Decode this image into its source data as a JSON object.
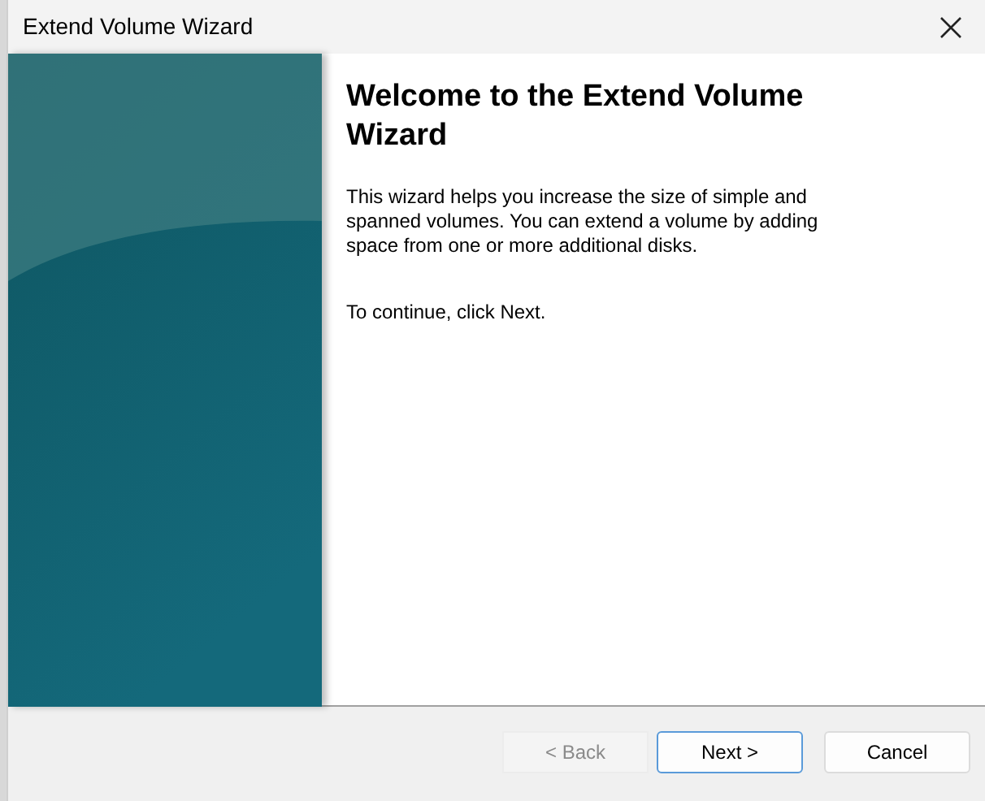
{
  "window": {
    "title": "Extend Volume Wizard"
  },
  "heading": "Welcome to the Extend Volume Wizard",
  "paragraphs": [
    "This wizard helps you increase the size of simple and spanned volumes. You can extend a volume by adding space from one or more additional disks.",
    "To continue, click Next."
  ],
  "buttons": [
    {
      "label": "< Back",
      "disabled": true,
      "selected": false
    },
    {
      "label": "Next >",
      "disabled": false,
      "selected": true
    },
    {
      "label": "Cancel",
      "disabled": false,
      "selected": false
    }
  ]
}
